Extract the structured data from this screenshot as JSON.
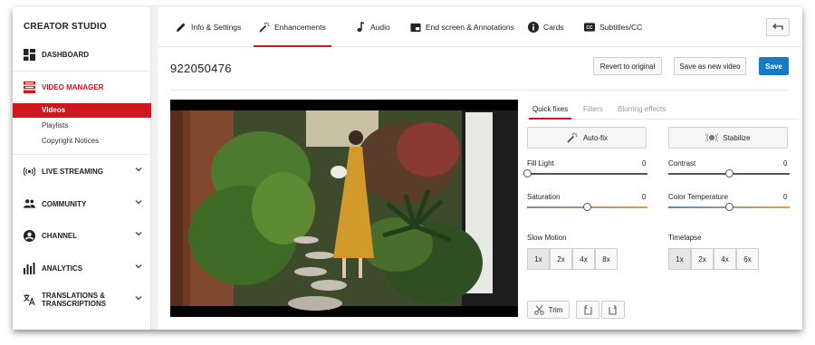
{
  "sidebar": {
    "brand": "CREATOR STUDIO",
    "items": [
      {
        "label": "DASHBOARD",
        "icon": "dashboard-icon"
      },
      {
        "label": "VIDEO MANAGER",
        "icon": "video-manager-icon"
      },
      {
        "label": "LIVE STREAMING",
        "icon": "live-streaming-icon"
      },
      {
        "label": "COMMUNITY",
        "icon": "community-icon"
      },
      {
        "label": "CHANNEL",
        "icon": "channel-icon"
      },
      {
        "label": "ANALYTICS",
        "icon": "analytics-icon"
      },
      {
        "label": "TRANSLATIONS & TRANSCRIPTIONS",
        "icon": "translate-icon"
      }
    ],
    "video_manager_sub": [
      "Videos",
      "Playlists",
      "Copyright Notices"
    ]
  },
  "tabs": [
    {
      "label": "Info & Settings",
      "icon": "pencil-icon"
    },
    {
      "label": "Enhancements",
      "icon": "magic-wand-icon"
    },
    {
      "label": "Audio",
      "icon": "music-note-icon"
    },
    {
      "label": "End screen & Annotations",
      "icon": "end-screen-icon"
    },
    {
      "label": "Cards",
      "icon": "info-icon"
    },
    {
      "label": "Subtitles/CC",
      "icon": "cc-icon"
    }
  ],
  "active_tab": "Enhancements",
  "video": {
    "title": "922050476"
  },
  "actions": {
    "revert": "Revert to original",
    "save_new": "Save as new video",
    "save": "Save"
  },
  "subtabs": [
    "Quick fixes",
    "Filters",
    "Blurring effects"
  ],
  "quick": {
    "autofix": "Auto-fix",
    "stabilize": "Stabilize"
  },
  "sliders": [
    {
      "label": "Fill Light",
      "value": "0",
      "level": 0.0
    },
    {
      "label": "Contrast",
      "value": "0",
      "level": 0.5
    },
    {
      "label": "Saturation",
      "value": "0",
      "level": 0.5
    },
    {
      "label": "Color Temperature",
      "value": "0",
      "level": 0.5
    }
  ],
  "slow_motion": {
    "label": "Slow Motion",
    "options": [
      "1x",
      "2x",
      "4x",
      "8x"
    ],
    "selected": "1x"
  },
  "timelapse": {
    "label": "Timelapse",
    "options": [
      "1x",
      "2x",
      "4x",
      "6x"
    ],
    "selected": "1x"
  },
  "trim": {
    "label": "Trim"
  },
  "colors": {
    "accent_red": "#cc181e",
    "save_blue": "#167ac6"
  }
}
